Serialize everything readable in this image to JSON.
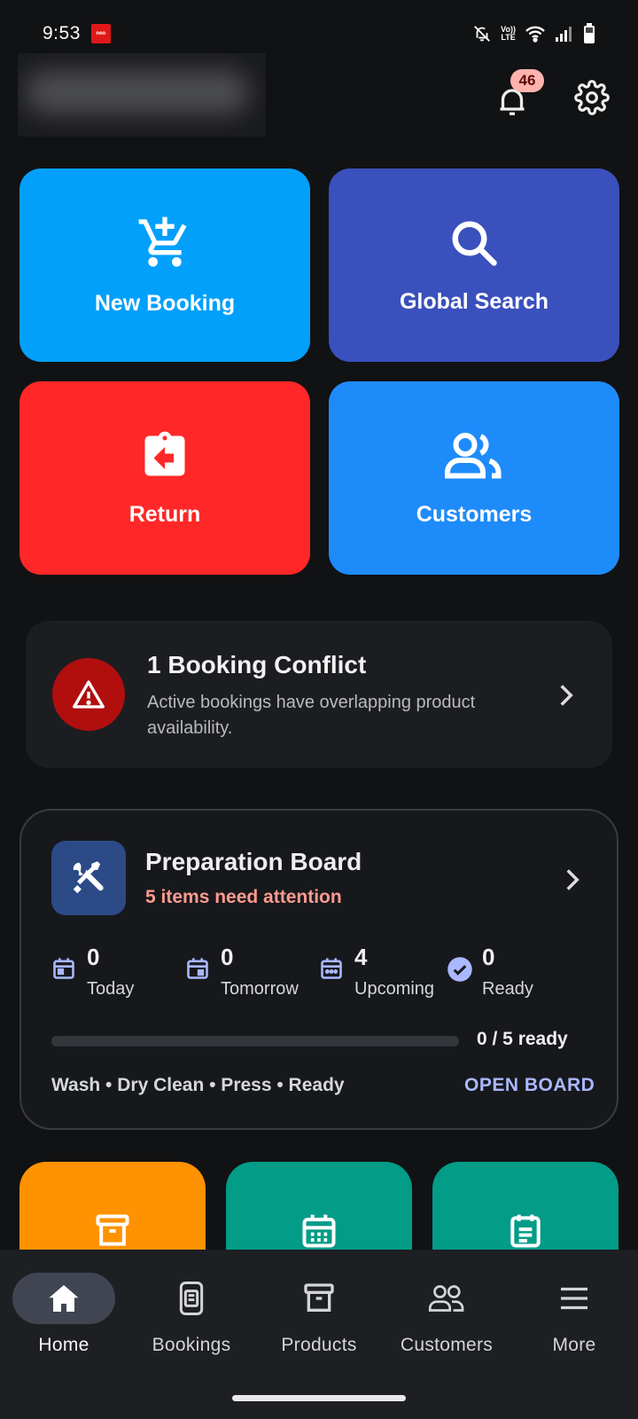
{
  "status_bar": {
    "time": "9:53",
    "carrier_badge": "neo",
    "lte_top": "Vo))",
    "lte_bottom": "LTE"
  },
  "header": {
    "notification_count": "46"
  },
  "actions": {
    "new_booking": "New Booking",
    "global_search": "Global Search",
    "return": "Return",
    "customers": "Customers"
  },
  "conflict": {
    "title": "1 Booking Conflict",
    "description": "Active bookings have overlapping product availability."
  },
  "prep_board": {
    "title": "Preparation Board",
    "subtitle": "5 items need attention",
    "stats": [
      {
        "value": "0",
        "label": "Today"
      },
      {
        "value": "0",
        "label": "Tomorrow"
      },
      {
        "value": "4",
        "label": "Upcoming"
      },
      {
        "value": "0",
        "label": "Ready"
      }
    ],
    "progress_fraction": 0,
    "progress_label": "0 / 5 ready",
    "stages": "Wash • Dry Clean • Press • Ready",
    "open_label": "OPEN BOARD"
  },
  "bottom_nav": {
    "items": [
      {
        "label": "Home",
        "icon": "home-icon",
        "active": true
      },
      {
        "label": "Bookings",
        "icon": "bookings-icon",
        "active": false
      },
      {
        "label": "Products",
        "icon": "products-icon",
        "active": false
      },
      {
        "label": "Customers",
        "icon": "customers-icon",
        "active": false
      },
      {
        "label": "More",
        "icon": "menu-icon",
        "active": false
      }
    ]
  },
  "colors": {
    "background": "#111214",
    "new_booking": "#03a0fb",
    "global_search": "#3a50bd",
    "return": "#ff2727",
    "customers": "#1e8bfb",
    "conflict_icon": "#b10e0e",
    "attention": "#ff9a8f",
    "accent_link": "#aab8ff"
  }
}
